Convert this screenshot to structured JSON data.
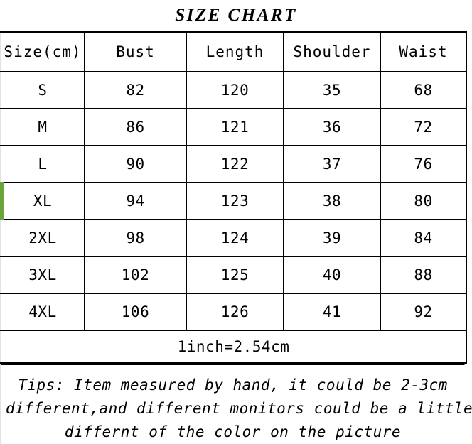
{
  "chart_data": {
    "type": "table",
    "title": "SIZE CHART",
    "columns": [
      "Size(cm)",
      "Bust",
      "Length",
      "Shoulder",
      "Waist"
    ],
    "rows": [
      [
        "S",
        "82",
        "120",
        "35",
        "68"
      ],
      [
        "M",
        "86",
        "121",
        "36",
        "72"
      ],
      [
        "L",
        "90",
        "122",
        "37",
        "76"
      ],
      [
        "XL",
        "94",
        "123",
        "38",
        "80"
      ],
      [
        "2XL",
        "98",
        "124",
        "39",
        "84"
      ],
      [
        "3XL",
        "102",
        "125",
        "40",
        "88"
      ],
      [
        "4XL",
        "106",
        "126",
        "41",
        "92"
      ]
    ],
    "highlighted_row_index": 3,
    "footer_note": "1inch=2.54cm",
    "tips": [
      "Tips: Item measured by hand, it could be 2-3cm",
      "different,and different monitors could be a little",
      "differnt of the color on the picture"
    ]
  },
  "title": {
    "text": "SIZE CHART"
  },
  "table": {
    "headers": {
      "size": "Size(cm)",
      "bust": "Bust",
      "length": "Length",
      "shoulder": "Shoulder",
      "waist": "Waist"
    },
    "rows": [
      {
        "size": "S",
        "bust": "82",
        "length": "120",
        "shoulder": "35",
        "waist": "68"
      },
      {
        "size": "M",
        "bust": "86",
        "length": "121",
        "shoulder": "36",
        "waist": "72"
      },
      {
        "size": "L",
        "bust": "90",
        "length": "122",
        "shoulder": "37",
        "waist": "76"
      },
      {
        "size": "XL",
        "bust": "94",
        "length": "123",
        "shoulder": "38",
        "waist": "80"
      },
      {
        "size": "2XL",
        "bust": "98",
        "length": "124",
        "shoulder": "39",
        "waist": "84"
      },
      {
        "size": "3XL",
        "bust": "102",
        "length": "125",
        "shoulder": "40",
        "waist": "88"
      },
      {
        "size": "4XL",
        "bust": "106",
        "length": "126",
        "shoulder": "41",
        "waist": "92"
      }
    ],
    "conversion_note": "1inch=2.54cm"
  },
  "tips": {
    "line1": "Tips: Item measured by hand, it could be 2-3cm",
    "line2": "different,and different monitors could be a little",
    "line3": "differnt of the color on the picture"
  },
  "colors": {
    "accent_green": "#6ba43a",
    "border_black": "#000000",
    "background": "#ffffff",
    "text": "#000000"
  }
}
